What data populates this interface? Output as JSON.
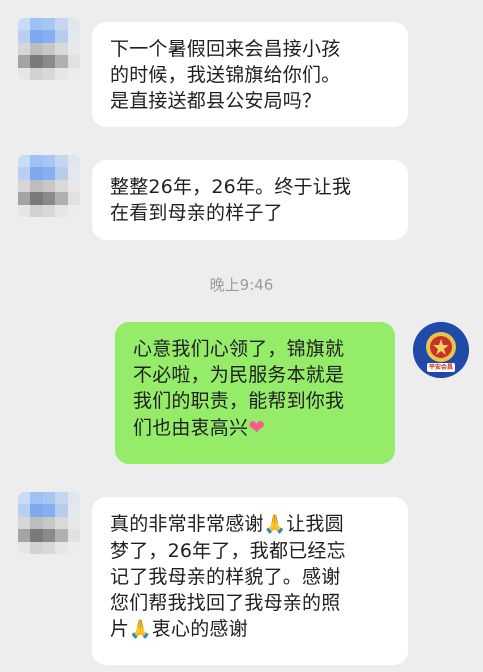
{
  "messages": [
    {
      "side": "in",
      "lines": [
        "下一个暑假回来会昌接小孩",
        "的时候，我送锦旗给你们。",
        "是直接送都县公安局吗？"
      ]
    },
    {
      "side": "in",
      "lines": [
        "整整26年，26年。终于让我",
        "在看到母亲的样子了"
      ]
    },
    {
      "side": "time",
      "text": "晚上9:46"
    },
    {
      "side": "out",
      "lines": [
        "心意我们心领了，锦旗就",
        "不必啦，为民服务本就是",
        "我们的职责，能帮到你我",
        "们也由衷高兴"
      ],
      "trailing_icon": "heart-emoji-icon"
    },
    {
      "side": "in",
      "lines": [
        "真的非常非常感谢",
        "梦了，26年了，我都已经忘",
        "记了我母亲的样貌了。感谢",
        "您们帮我找回了我母亲的照",
        "片"
      ],
      "line1_suffix": "让我圆",
      "line5_suffix": "衷心的感谢"
    }
  ],
  "emoji": {
    "pray": "🙏",
    "heart": "❤"
  },
  "police_avatar": {
    "icon": "police-badge-icon",
    "caption": "平安会昌"
  },
  "colors": {
    "background": "#ededed",
    "incoming_bubble": "#ffffff",
    "outgoing_bubble": "#95ec69",
    "timestamp": "#9b9b9b"
  }
}
